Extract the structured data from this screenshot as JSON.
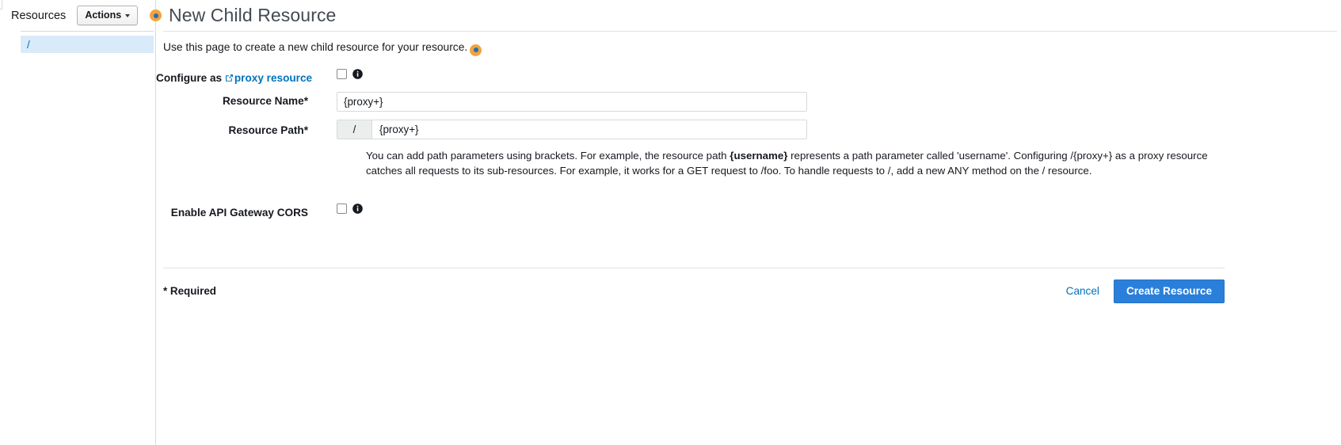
{
  "sidebar": {
    "resources_label": "Resources",
    "actions_button": "Actions",
    "tree_items": [
      {
        "label": "/"
      }
    ]
  },
  "header": {
    "title": "New Child Resource",
    "marker_color": "#f2a33c",
    "marker_center_color": "#1f6fbf"
  },
  "intro": {
    "text": "Use this page to create a new child resource for your resource."
  },
  "form": {
    "proxy_row": {
      "label_prefix": "Configure as ",
      "link_text": "proxy resource",
      "checkbox_checked": false
    },
    "resource_name": {
      "label": "Resource Name*",
      "value": "{proxy+}",
      "placeholder": ""
    },
    "resource_path": {
      "label": "Resource Path*",
      "prefix": "/",
      "value": "{proxy+}",
      "placeholder": ""
    },
    "help": {
      "part1": "You can add path parameters using brackets. For example, the resource path ",
      "bold": "{username}",
      "part2": " represents a path parameter called 'username'. Configuring /{proxy+} as a proxy resource catches all requests to its sub-resources. For example, it works for a GET request to /foo. To handle requests to /, add a new ANY method on the / resource."
    },
    "cors_row": {
      "label": "Enable API Gateway CORS",
      "checkbox_checked": false
    }
  },
  "footer": {
    "required_note": "* Required",
    "cancel_label": "Cancel",
    "create_label": "Create Resource",
    "primary_color": "#2a7fdb",
    "link_color": "#0073bb"
  }
}
